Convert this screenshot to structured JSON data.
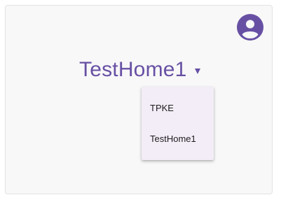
{
  "header": {
    "home_name": "TestHome1",
    "dropdown_icon": "arrow-drop-down-icon",
    "avatar_icon": "account-circle-icon"
  },
  "home_menu": {
    "items": [
      {
        "label": "TPKE"
      },
      {
        "label": "TestHome1"
      }
    ]
  },
  "colors": {
    "primary": "#6750a4",
    "menu_background": "#f3edf7",
    "surface": "#f8f8f8"
  }
}
